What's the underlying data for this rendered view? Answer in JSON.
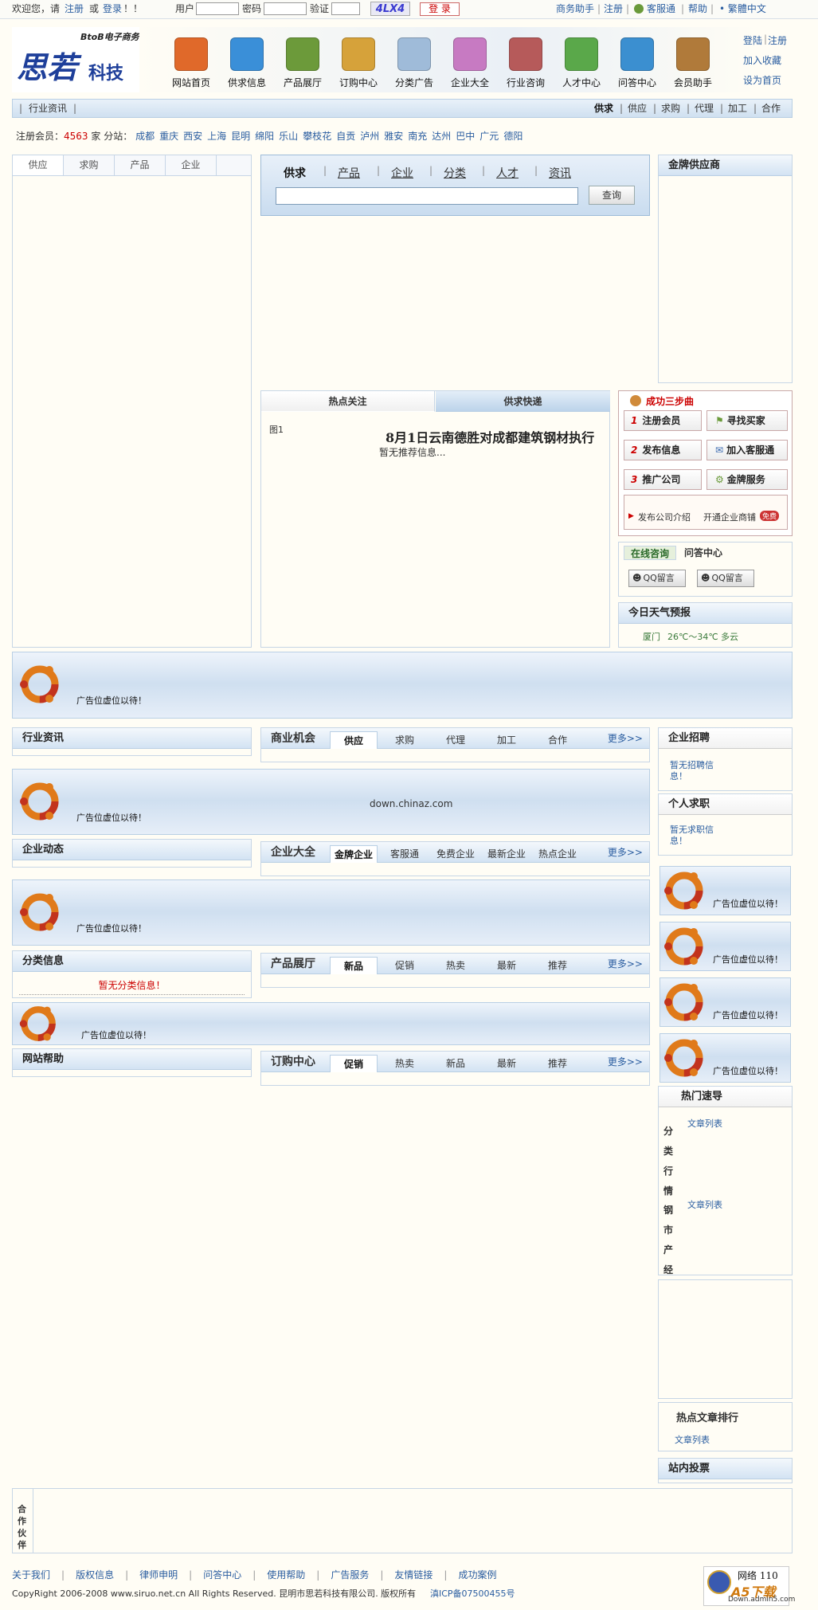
{
  "topbar": {
    "welcome": "欢迎您，请",
    "register": "注册",
    "or": "或",
    "login": "登录",
    "excl": "！！",
    "user_label": "用户",
    "pass_label": "密码",
    "verify_label": "验证",
    "captcha": "4LX4",
    "login_btn": "登 录",
    "links": [
      "商务助手",
      "注册",
      "客服通",
      "帮助",
      "• 繁體中文"
    ]
  },
  "header": {
    "logo_small": "BtoB电子商务",
    "logo_main": "思若",
    "logo_sub": "科技",
    "side_links": [
      "登陆",
      "注册",
      "加入收藏",
      "设为首页"
    ],
    "nav": [
      {
        "label": "网站首页",
        "color": "#e0692a"
      },
      {
        "label": "供求信息",
        "color": "#3a8fd8"
      },
      {
        "label": "产品展厅",
        "color": "#6c9a3a"
      },
      {
        "label": "订购中心",
        "color": "#d6a23a"
      },
      {
        "label": "分类广告",
        "color": "#9fbbd9"
      },
      {
        "label": "企业大全",
        "color": "#c77ac2"
      },
      {
        "label": "行业咨询",
        "color": "#b65a5a"
      },
      {
        "label": "人才中心",
        "color": "#5aa84a"
      },
      {
        "label": "问答中心",
        "color": "#3b8fd0"
      },
      {
        "label": "会员助手",
        "color": "#b07a3a"
      }
    ]
  },
  "subnav": {
    "left": "行业资讯",
    "right": [
      "供求",
      "供应",
      "求购",
      "代理",
      "加工",
      "合作"
    ]
  },
  "cities": {
    "label": "注册会员：",
    "count": "4563",
    "unit": "家",
    "branch": "分站：",
    "list": [
      "成都",
      "重庆",
      "西安",
      "上海",
      "昆明",
      "绵阳",
      "乐山",
      "攀枝花",
      "自贡",
      "泸州",
      "雅安",
      "南充",
      "达州",
      "巴中",
      "广元",
      "德阳"
    ]
  },
  "lefttabs": [
    "供应",
    "求购",
    "产品",
    "企业"
  ],
  "search": {
    "tabs": [
      "供求",
      "产品",
      "企业",
      "分类",
      "人才",
      "资讯"
    ],
    "button": "查询",
    "value": ""
  },
  "gold": {
    "title": "金牌供应商"
  },
  "hot": {
    "tab1": "热点关注",
    "tab2": "供求快递",
    "img": "图1",
    "headline": "8月1日云南德胜对成都建筑钢材执行",
    "norec": "暂无推荐信息..."
  },
  "steps": {
    "title": "成功三步曲",
    "btns": [
      {
        "num": "1",
        "label": "注册会员"
      },
      {
        "label": "寻找买家"
      },
      {
        "num": "2",
        "label": "发布信息"
      },
      {
        "label": "加入客服通"
      },
      {
        "num": "3",
        "label": "推广公司"
      },
      {
        "label": "金牌服务"
      }
    ],
    "link1": "发布公司介绍",
    "link2": "开通企业商铺",
    "badge": "免费"
  },
  "consult": {
    "tab1": "在线咨询",
    "tab2": "问答中心",
    "qq1": "QQ留言",
    "qq2": "QQ留言"
  },
  "weather": {
    "title": "今日天气预报",
    "city": "厦门",
    "temp": "26℃～34℃",
    "desc": "多云"
  },
  "ad_text": "广告位虚位以待！",
  "ad_center_text": "down.chinaz.com",
  "sections": {
    "news": "行业资讯",
    "biz": {
      "title": "商业机会",
      "tabs": [
        "供应",
        "求购",
        "代理",
        "加工",
        "合作"
      ],
      "more": "更多>>"
    },
    "dynamic": "企业动态",
    "ent": {
      "title": "企业大全",
      "tabs": [
        "金牌企业",
        "客服通",
        "免费企业",
        "最新企业",
        "热点企业"
      ],
      "more": "更多>>"
    },
    "classify": "分类信息",
    "classify_empty": "暂无分类信息！",
    "prod": {
      "title": "产品展厅",
      "tabs": [
        "新品",
        "促销",
        "热卖",
        "最新",
        "推荐"
      ],
      "more": "更多>>"
    },
    "help": "网站帮助",
    "order": {
      "title": "订购中心",
      "tabs": [
        "促销",
        "热卖",
        "新品",
        "最新",
        "推荐"
      ],
      "more": "更多>>"
    }
  },
  "right": {
    "recruit": "企业招聘",
    "recruit_empty": "暂无招聘信息！",
    "job": "个人求职",
    "job_empty": "暂无求职信息！",
    "hotnav": "热门速导",
    "cat1": "分类行情",
    "cat2": "钢市产经",
    "article_list": "文章列表",
    "rank": "热点文章排行",
    "vote": "站内投票"
  },
  "partner": {
    "title": "合作伙伴"
  },
  "footer": {
    "links": [
      "关于我们",
      "版权信息",
      "律师申明",
      "问答中心",
      "使用帮助",
      "广告服务",
      "友情链接",
      "成功案例"
    ],
    "copyright": "CopyRight 2006-2008 www.siruo.net.cn All Rights Reserved. 昆明市思若科技有限公司. 版权所有",
    "icp": "滇ICP备07500455号",
    "badge_top": "网络 110",
    "badge_logo": "A5下载",
    "badge_url": "Down.admin5.com"
  }
}
